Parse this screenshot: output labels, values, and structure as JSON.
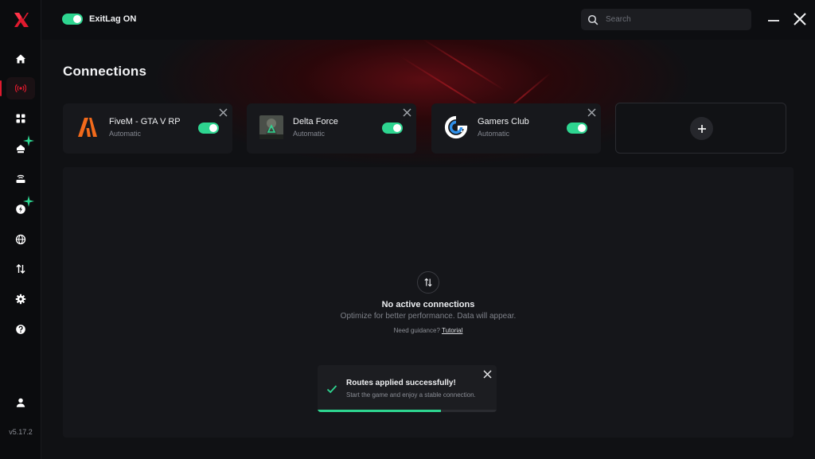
{
  "app": {
    "master_toggle_label": "ExitLag ON",
    "master_toggle_on": true,
    "version": "v5.17.2",
    "logo_icon": "exitlag-logo"
  },
  "search": {
    "placeholder": "Search",
    "value": "",
    "icon": "search-icon"
  },
  "window_controls": [
    {
      "name": "minimize-icon"
    },
    {
      "name": "close-icon"
    }
  ],
  "sidebar": {
    "items": [
      {
        "icon": "home-icon",
        "active": false
      },
      {
        "icon": "connections-icon",
        "active": true
      },
      {
        "icon": "apps-grid-icon",
        "active": false
      },
      {
        "icon": "network-icon",
        "active": false,
        "badge": "plus"
      },
      {
        "icon": "router-icon",
        "active": false
      },
      {
        "icon": "boost-icon",
        "active": false,
        "badge": "plus"
      },
      {
        "icon": "globe-icon",
        "active": false
      },
      {
        "icon": "transfer-icon",
        "active": false
      },
      {
        "icon": "settings-icon",
        "active": false
      },
      {
        "icon": "help-icon",
        "active": false
      },
      {
        "icon": "user-icon",
        "active": false
      }
    ]
  },
  "page": {
    "title": "Connections"
  },
  "cards": [
    {
      "name": "FiveM - GTA V RP",
      "mode": "Automatic",
      "enabled": true,
      "icon": "fivem-icon"
    },
    {
      "name": "Delta Force",
      "mode": "Automatic",
      "enabled": true,
      "icon": "delta-force-icon"
    },
    {
      "name": "Gamers Club",
      "mode": "Automatic",
      "enabled": true,
      "icon": "gamers-club-icon"
    }
  ],
  "add_card": {
    "icon": "plus-icon"
  },
  "empty_state": {
    "icon": "swap-icon",
    "title": "No active connections",
    "subtitle": "Optimize for better performance. Data will appear.",
    "guidance_text": "Need guidance?",
    "tutorial_link": "Tutorial"
  },
  "toast": {
    "icon": "check-icon",
    "title": "Routes applied successfully!",
    "message": "Start the game and enjoy a stable connection.",
    "progress": 0.69
  },
  "colors": {
    "accent_green": "#2ed590",
    "brand_red": "#e01a2e",
    "background": "#101114",
    "card": "#17181c"
  }
}
